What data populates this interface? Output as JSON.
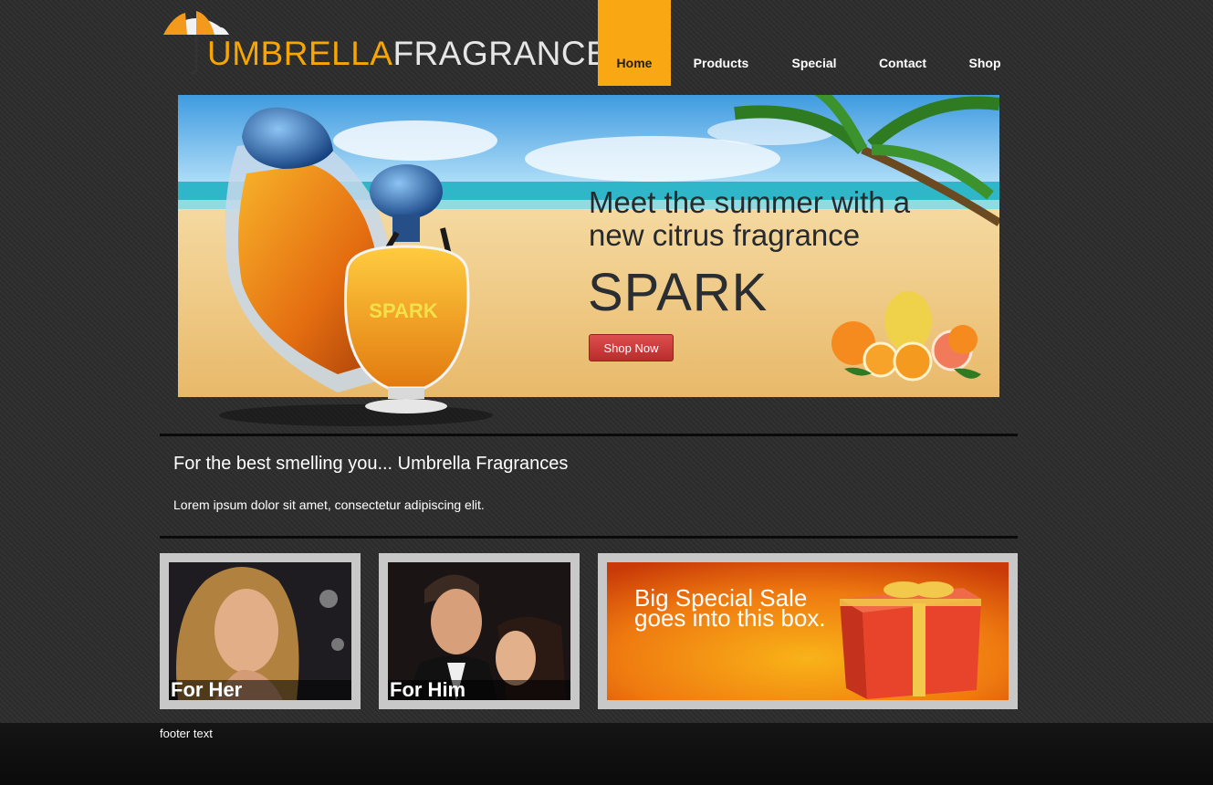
{
  "header": {
    "logo": {
      "word1": "UMBRELLA",
      "word2": "FRAGRANCES",
      "icon": "umbrella-icon"
    },
    "nav": [
      {
        "label": "Home",
        "active": true
      },
      {
        "label": "Products",
        "active": false
      },
      {
        "label": "Special",
        "active": false
      },
      {
        "label": "Contact",
        "active": false
      },
      {
        "label": "Shop",
        "active": false
      }
    ]
  },
  "hero": {
    "headline_line1": "Meet the summer with a",
    "headline_line2": "new citrus fragrance",
    "product_name": "SPARK",
    "bottle_label": "SPARK",
    "cta_label": "Shop Now"
  },
  "intro": {
    "title": "For the best smelling you... Umbrella Fragrances",
    "text": "Lorem ipsum dolor sit amet, consectetur adipiscing elit."
  },
  "tiles": {
    "her": {
      "caption": "For Her"
    },
    "him": {
      "caption": "For Him"
    },
    "sale": {
      "line1": "Big Special Sale",
      "line2": "goes into this box."
    }
  },
  "footer": {
    "text": "footer text"
  },
  "colors": {
    "accent": "#f9a712",
    "cta": "#c93a3a",
    "background": "#2e2e2e"
  }
}
